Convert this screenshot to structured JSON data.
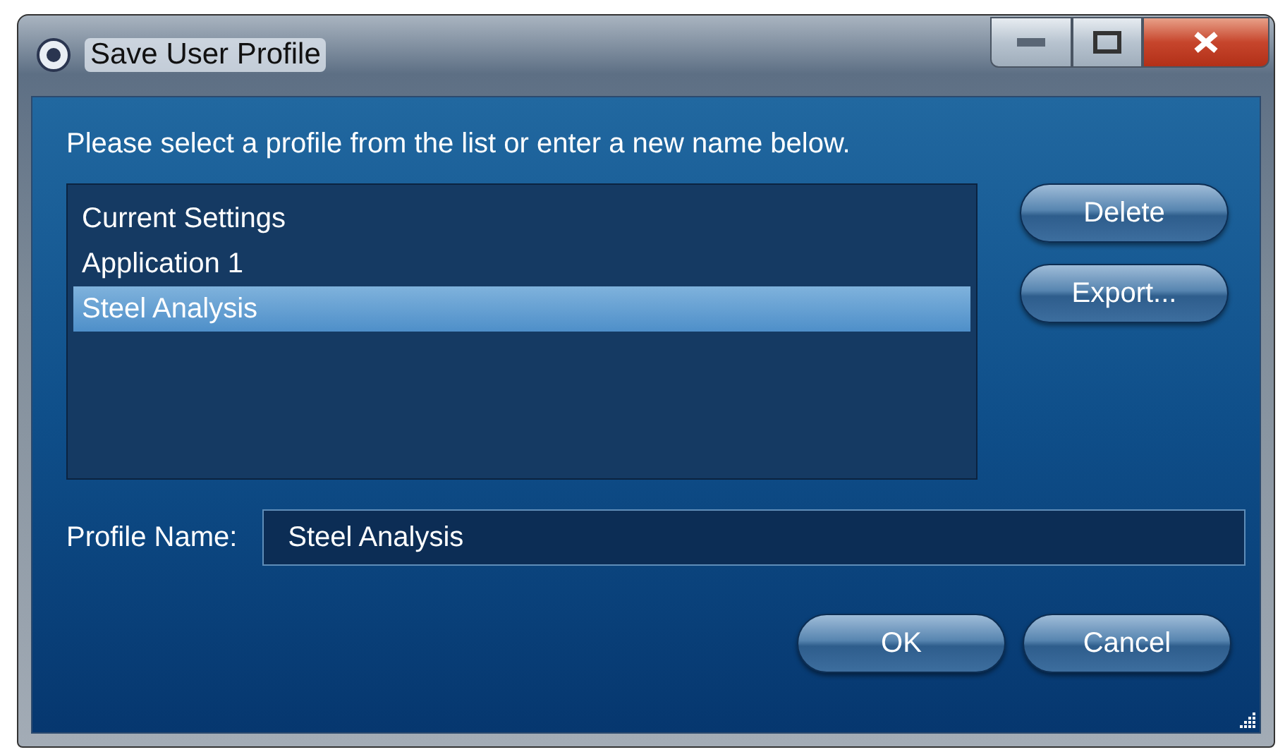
{
  "window": {
    "title": "Save User Profile"
  },
  "instruction": "Please select a profile from the list or enter a new name below.",
  "profiles": [
    {
      "label": "Current Settings",
      "selected": false
    },
    {
      "label": "Application 1",
      "selected": false
    },
    {
      "label": "Steel Analysis",
      "selected": true
    }
  ],
  "side_buttons": [
    "Delete",
    "Export..."
  ],
  "profile_name": {
    "label": "Profile Name:",
    "value": "Steel Analysis"
  },
  "buttons": [
    "OK",
    "Cancel"
  ]
}
